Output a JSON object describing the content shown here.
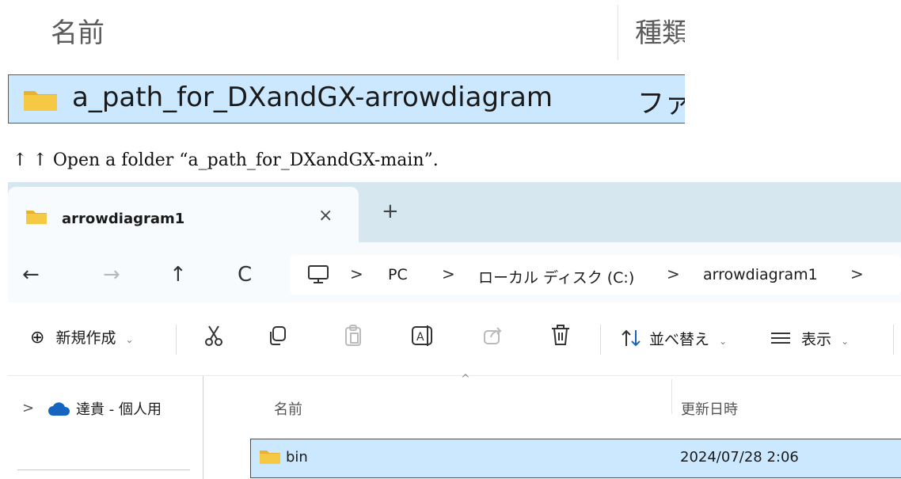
{
  "top_crop": {
    "column_name": "名前",
    "column_type": "種類",
    "row": {
      "name": "a_path_for_DXandGX-arrowdiagram",
      "type": "ファイ",
      "icon": "folder-icon"
    }
  },
  "caption": "↑ ↑ Open a folder “a_path_for_DXandGX-main”.",
  "explorer": {
    "tab": {
      "label": "arrowdiagram1",
      "close": "×",
      "add": "+"
    },
    "nav": {
      "back": "←",
      "forward": "→",
      "up": "↑",
      "refresh": "C"
    },
    "address": {
      "icon": "computer-icon",
      "crumbs": [
        "PC",
        "ローカル ディスク (C:)",
        "arrowdiagram1"
      ],
      "separator": ">"
    },
    "toolbar": {
      "new": "新規作成",
      "new_icon": "⊕",
      "sort": "並べ替え",
      "view": "表示",
      "caret": "⌄",
      "icons": [
        "cut-icon",
        "copy-icon",
        "paste-icon",
        "rename-icon",
        "share-icon",
        "delete-icon",
        "sort-icon",
        "view-icon"
      ]
    },
    "nav_pane": {
      "expand": ">",
      "item": "達貴 - 個人用",
      "icon": "cloud-icon"
    },
    "columns": {
      "name": "名前",
      "date": "更新日時",
      "sort_indicator": "^"
    },
    "rows": [
      {
        "name": "bin",
        "date": "2024/07/28 2:06",
        "icon": "folder-icon"
      }
    ],
    "colors": {
      "tabbar": "#d7e7f0",
      "selection": "#cce8ff",
      "folder": "#f4c542",
      "cloud": "#1565c0"
    }
  }
}
